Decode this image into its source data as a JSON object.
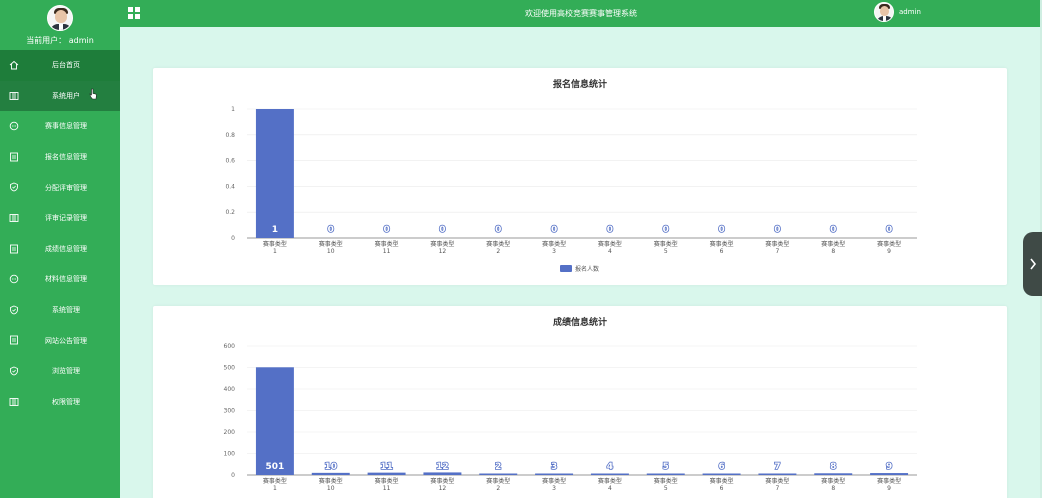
{
  "sidebar": {
    "current_user_label": "当前用户：",
    "current_user_name": "admin",
    "items": [
      {
        "label": "后台首页",
        "icon": "home-icon"
      },
      {
        "label": "系统用户",
        "icon": "columns-icon"
      },
      {
        "label": "赛事信息管理",
        "icon": "message-icon"
      },
      {
        "label": "报名信息管理",
        "icon": "document-icon"
      },
      {
        "label": "分配评审管理",
        "icon": "shield-icon"
      },
      {
        "label": "评审记录管理",
        "icon": "columns-icon"
      },
      {
        "label": "成绩信息管理",
        "icon": "document-icon"
      },
      {
        "label": "材料信息管理",
        "icon": "message-icon"
      },
      {
        "label": "系统管理",
        "icon": "shield-icon"
      },
      {
        "label": "网站公告管理",
        "icon": "document-icon"
      },
      {
        "label": "浏览管理",
        "icon": "shield-icon"
      },
      {
        "label": "权限管理",
        "icon": "columns-icon"
      }
    ]
  },
  "header": {
    "title": "欢迎使用高校竞赛赛事管理系统",
    "user": "admin"
  },
  "colors": {
    "sidebar_bg": "#33ad57",
    "active_bg": "#1e7d3a",
    "bar": "#5470c6",
    "page_bg": "#d9f7ec"
  },
  "chart_data": [
    {
      "type": "bar",
      "title": "报名信息统计",
      "categories": [
        "赛事类型1",
        "赛事类型10",
        "赛事类型11",
        "赛事类型12",
        "赛事类型2",
        "赛事类型3",
        "赛事类型4",
        "赛事类型5",
        "赛事类型6",
        "赛事类型7",
        "赛事类型8",
        "赛事类型9"
      ],
      "cat_line1": "赛事类型",
      "cat_line2": [
        "1",
        "10",
        "11",
        "12",
        "2",
        "3",
        "4",
        "5",
        "6",
        "7",
        "8",
        "9"
      ],
      "series": [
        {
          "name": "报名人数",
          "values": [
            1,
            0,
            0,
            0,
            0,
            0,
            0,
            0,
            0,
            0,
            0,
            0
          ]
        }
      ],
      "yticks": [
        "0",
        "0.2",
        "0.4",
        "0.6",
        "0.8",
        "1"
      ],
      "ylim": [
        0,
        1
      ],
      "grid": true,
      "legend": "bottom-center"
    },
    {
      "type": "bar",
      "title": "成绩信息统计",
      "categories": [
        "赛事类型1",
        "赛事类型10",
        "赛事类型11",
        "赛事类型12",
        "赛事类型2",
        "赛事类型3",
        "赛事类型4",
        "赛事类型5",
        "赛事类型6",
        "赛事类型7",
        "赛事类型8",
        "赛事类型9"
      ],
      "cat_line1": "赛事类型",
      "cat_line2": [
        "1",
        "10",
        "11",
        "12",
        "2",
        "3",
        "4",
        "5",
        "6",
        "7",
        "8",
        "9"
      ],
      "series": [
        {
          "name": "",
          "values": [
            501,
            10,
            11,
            12,
            2,
            3,
            4,
            5,
            6,
            7,
            8,
            9
          ]
        }
      ],
      "yticks": [
        "0",
        "100",
        "200",
        "300",
        "400",
        "500",
        "600"
      ],
      "ylim": [
        0,
        600
      ],
      "grid": true
    }
  ]
}
